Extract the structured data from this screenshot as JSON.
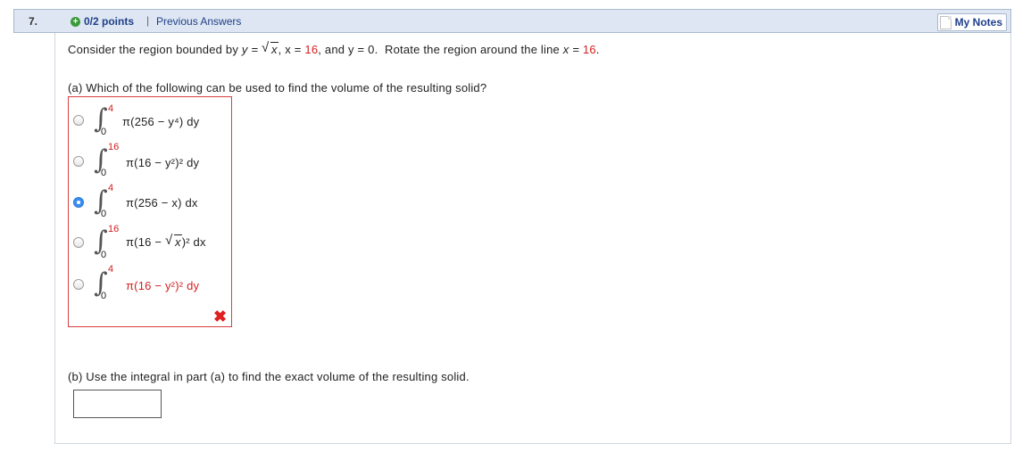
{
  "header": {
    "question_number": "7.",
    "points": "0/2 points",
    "separator": "|",
    "previous_answers": "Previous Answers",
    "my_notes": "My Notes"
  },
  "problem": {
    "lead": "Consider the region bounded by",
    "y_eq": "y =",
    "sqrt_arg": "x",
    "x_eq": ", x =",
    "x_val": "16",
    "and_y": ", and y =",
    "y_val": "0.",
    "rotate": "Rotate the region around the line",
    "line_x": "x =",
    "line_val": "16",
    "period": "."
  },
  "part_a": {
    "question": "(a) Which of the following can be used to find the volume of the resulting solid?",
    "choices": [
      {
        "upper": "4",
        "lower": "0",
        "integrand": "π(256 − y⁴) dy",
        "selected": false
      },
      {
        "upper": "16",
        "lower": "0",
        "integrand": "π(16 − y²)² dy",
        "selected": false
      },
      {
        "upper": "4",
        "lower": "0",
        "integrand": "π(256 − x) dx",
        "selected": true
      },
      {
        "upper": "16",
        "lower": "0",
        "integrand_pre": "π(16 −",
        "integrand_sqrt": "x",
        "integrand_post": ")² dx",
        "selected": false
      },
      {
        "upper": "4",
        "lower": "0",
        "integrand": "π(16 − y²)² dy",
        "selected": false
      }
    ],
    "result_mark": "✖"
  },
  "part_b": {
    "question": "(b) Use the integral in part (a) to find the exact volume of the resulting solid.",
    "answer_value": ""
  },
  "colors": {
    "header_bg": "#dde6f2",
    "link": "#1f3f8a",
    "wrong": "#d42020",
    "selected_radio": "#3b8ef0"
  }
}
